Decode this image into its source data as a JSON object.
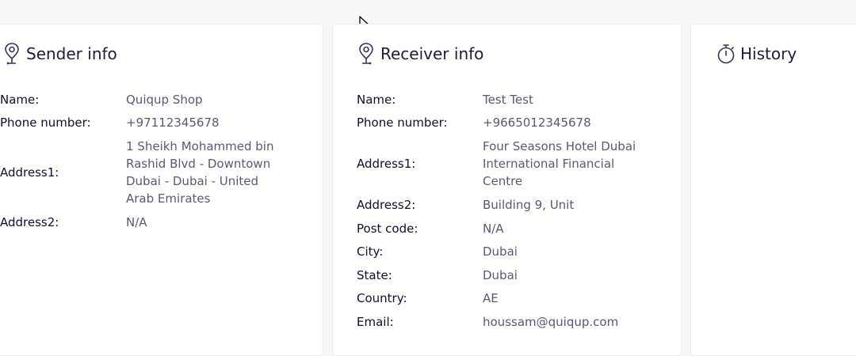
{
  "sender": {
    "title": "Sender info",
    "rows": [
      {
        "label": "Name:",
        "value": "Quiqup Shop"
      },
      {
        "label": "Phone number:",
        "value": "+97112345678"
      },
      {
        "label": "Address1:",
        "value": "1 Sheikh Mohammed bin Rashid Blvd - Downtown Dubai - Dubai - United Arab Emirates"
      },
      {
        "label": "Address2:",
        "value": "N/A"
      }
    ]
  },
  "receiver": {
    "title": "Receiver info",
    "rows": [
      {
        "label": "Name:",
        "value": "Test Test"
      },
      {
        "label": "Phone number:",
        "value": "+9665012345678"
      },
      {
        "label": "Address1:",
        "value": "Four Seasons Hotel Dubai International Financial Centre"
      },
      {
        "label": "Address2:",
        "value": "Building 9, Unit"
      },
      {
        "label": "Post code:",
        "value": "N/A"
      },
      {
        "label": "City:",
        "value": "Dubai"
      },
      {
        "label": "State:",
        "value": "Dubai"
      },
      {
        "label": "Country:",
        "value": "AE"
      },
      {
        "label": "Email:",
        "value": "houssam@quiqup.com"
      }
    ]
  },
  "history": {
    "title": "History"
  },
  "icons": {
    "sender": "location-pin-icon",
    "receiver": "location-pin-icon",
    "history": "stopwatch-icon",
    "cursor": "mouse-pointer-icon"
  }
}
